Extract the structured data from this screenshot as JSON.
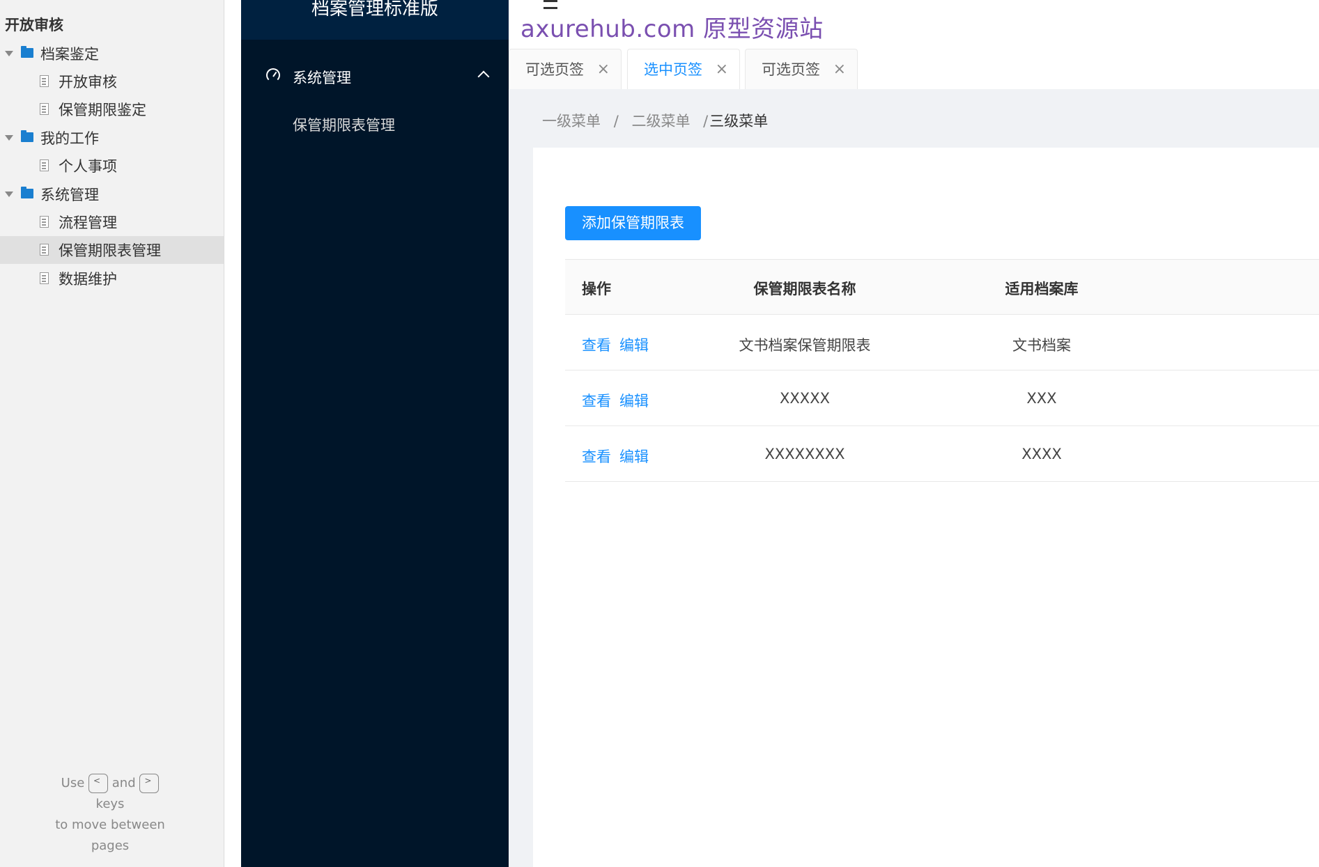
{
  "pages_panel": {
    "title": "开放审核",
    "tree": [
      {
        "type": "folder",
        "label": "档案鉴定"
      },
      {
        "type": "page",
        "label": "开放审核"
      },
      {
        "type": "page",
        "label": "保管期限鉴定"
      },
      {
        "type": "folder",
        "label": "我的工作"
      },
      {
        "type": "page",
        "label": "个人事项"
      },
      {
        "type": "folder",
        "label": "系统管理"
      },
      {
        "type": "page",
        "label": "流程管理"
      },
      {
        "type": "page",
        "label": "保管期限表管理",
        "selected": true
      },
      {
        "type": "page",
        "label": "数据维护"
      }
    ],
    "hint": {
      "use": "Use",
      "and": "and",
      "keys": "keys",
      "line3": "to move between",
      "line4": "pages",
      "key_prev": "<",
      "key_next": ">"
    }
  },
  "app": {
    "brand": "档案管理标准版",
    "menu_group": "系统管理",
    "submenu_item": "保管期限表管理"
  },
  "header": {
    "watermark": "axurehub.com 原型资源站",
    "tabs": [
      {
        "label": "可选页签",
        "active": false
      },
      {
        "label": "选中页签",
        "active": true
      },
      {
        "label": "可选页签",
        "active": false
      }
    ],
    "close_glyph": "×"
  },
  "breadcrumb": {
    "level1": "一级菜单",
    "level2": "二级菜单",
    "level3": "三级菜单",
    "sep": "/"
  },
  "content": {
    "add_button": "添加保管期限表",
    "table": {
      "headers": [
        "操作",
        "保管期限表名称",
        "适用档案库"
      ],
      "action_view": "查看",
      "action_edit": "编辑",
      "rows": [
        {
          "name": "文书档案保管期限表",
          "library": "文书档案"
        },
        {
          "name": "XXXXX",
          "library": "XXX"
        },
        {
          "name": "XXXXXXXX",
          "library": "XXXX"
        }
      ]
    }
  }
}
